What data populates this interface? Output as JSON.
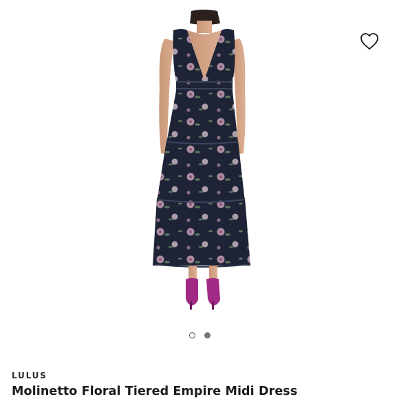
{
  "product": {
    "brand": "LULUS",
    "title": "Molinetto Floral Tiered Empire Midi Dress"
  },
  "gallery": {
    "image_count": 2,
    "active_index": 1
  },
  "icons": {
    "wishlist": "heart-outline-icon"
  },
  "colors": {
    "dress_navy": "#1e2436",
    "shoe_magenta": "#a02a86",
    "active_dot": "#777777"
  }
}
